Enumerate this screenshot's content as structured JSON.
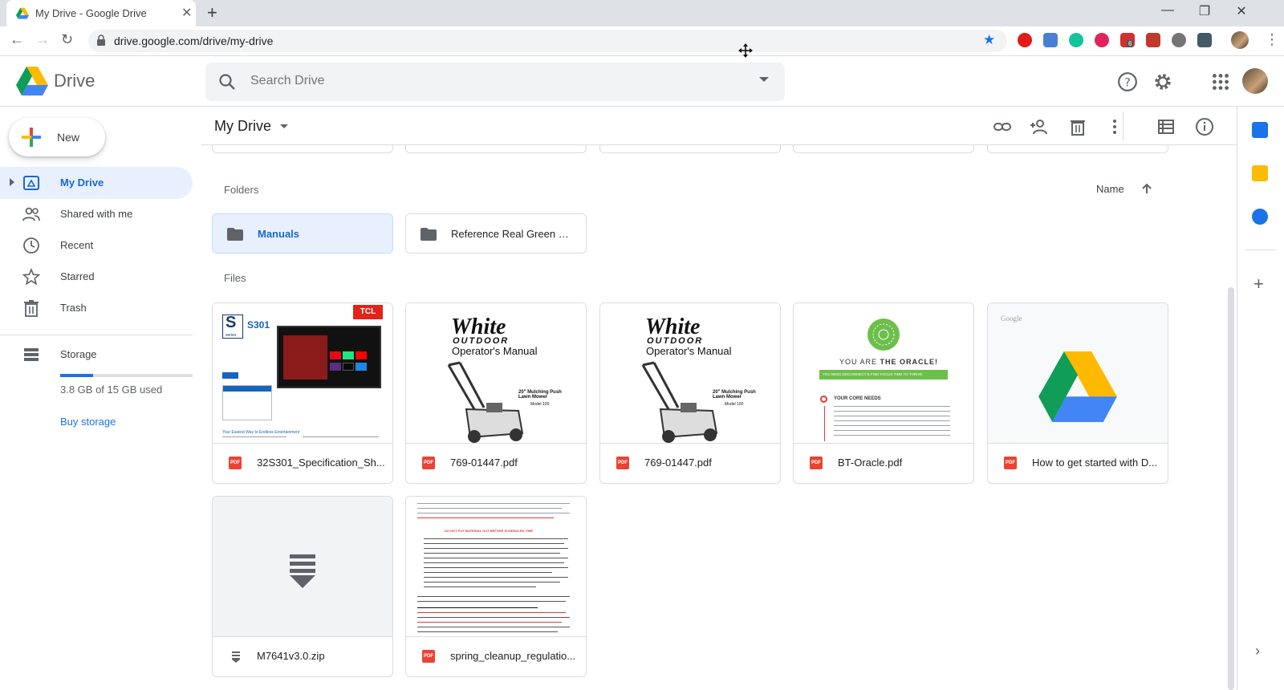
{
  "browser": {
    "tab_title": "My Drive - Google Drive",
    "url": "drive.google.com/drive/my-drive",
    "ext_badge": "6"
  },
  "drive": {
    "brand": "Drive",
    "search_placeholder": "Search Drive"
  },
  "sidebar": {
    "new_label": "New",
    "items": [
      {
        "label": "My Drive",
        "icon": "drive-icon"
      },
      {
        "label": "Shared with me",
        "icon": "people-icon"
      },
      {
        "label": "Recent",
        "icon": "clock-icon"
      },
      {
        "label": "Starred",
        "icon": "star-icon"
      },
      {
        "label": "Trash",
        "icon": "trash-icon"
      }
    ],
    "storage_label": "Storage",
    "storage_used": "3.8 GB of 15 GB used",
    "storage_fraction": 0.25,
    "buy_storage": "Buy storage"
  },
  "main": {
    "title": "My Drive",
    "folders_header": "Folders",
    "files_header": "Files",
    "sort_label": "Name",
    "folders": [
      {
        "name": "Manuals",
        "selected": true
      },
      {
        "name": "Reference Real Green Sy...",
        "selected": false
      }
    ],
    "files": [
      {
        "name": "32S301_Specification_Sh...",
        "type": "PDF"
      },
      {
        "name": "769-01447.pdf",
        "type": "PDF"
      },
      {
        "name": "769-01447.pdf",
        "type": "PDF"
      },
      {
        "name": "BT-Oracle.pdf",
        "type": "PDF"
      },
      {
        "name": "How to get started with D...",
        "type": "PDF"
      },
      {
        "name": "M7641v3.0.zip",
        "type": "ZIP"
      },
      {
        "name": "spring_cleanup_regulatio...",
        "type": "PDF"
      }
    ]
  },
  "thumbs": {
    "tcl_brand": "TCL",
    "tcl_series": "S",
    "tcl_series_word": "series",
    "tcl_model": "S301",
    "tcl_tagline": "Your Easiest Way to Endless Entertainment",
    "white_brand": "White",
    "white_outdoor": "OUTDOOR",
    "white_manual": "Operator's Manual",
    "white_model": "20\" Mulching Push Lawn Mower",
    "white_model_no": "Model 100",
    "oracle_title_a": "YOU ARE ",
    "oracle_title_b": "THE ORACLE!",
    "oracle_banner": "YOU NEED DISCONNECT & FIND FOCUS TIME TO THRIVE",
    "oracle_needs": "YOUR CORE NEEDS",
    "google_word": "Google",
    "spring_warning": "DO NOT PUT MATERIAL OUT BEFORE SCHEDULED TIME"
  },
  "colors": {
    "accent": "#1a73e8",
    "selected_bg": "#e8f0fe",
    "pdf_red": "#ea4335"
  }
}
